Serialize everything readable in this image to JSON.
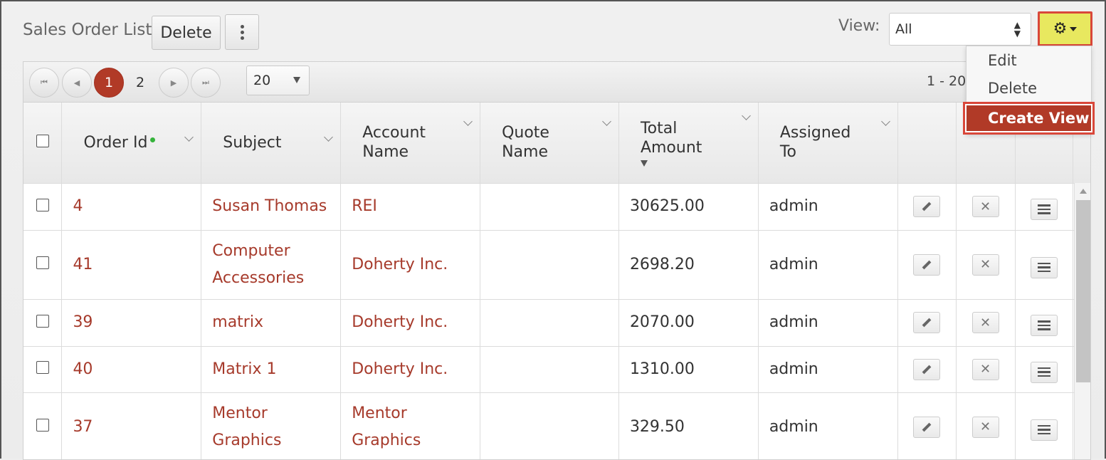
{
  "header": {
    "title": "Sales Order List",
    "delete_label": "Delete",
    "view_label": "View:",
    "view_value": "All"
  },
  "dropdown": {
    "items": [
      "Edit",
      "Delete",
      "Create View"
    ]
  },
  "pager": {
    "pages": [
      "1",
      "2"
    ],
    "current_page": "1",
    "page_size": "20",
    "range_text": "1 - 20"
  },
  "table": {
    "columns": [
      "Order Id",
      "Subject",
      "Account Name",
      "Quote Name",
      "Total Amount",
      "Assigned To"
    ],
    "rows": [
      {
        "order_id": "4",
        "subject": "Susan Thomas",
        "account": "REI",
        "quote": "",
        "total": "30625.00",
        "assigned": "admin"
      },
      {
        "order_id": "41",
        "subject": "Computer Accessories",
        "account": "Doherty Inc.",
        "quote": "",
        "total": "2698.20",
        "assigned": "admin"
      },
      {
        "order_id": "39",
        "subject": "matrix",
        "account": "Doherty Inc.",
        "quote": "",
        "total": "2070.00",
        "assigned": "admin"
      },
      {
        "order_id": "40",
        "subject": "Matrix 1",
        "account": "Doherty Inc.",
        "quote": "",
        "total": "1310.00",
        "assigned": "admin"
      },
      {
        "order_id": "37",
        "subject": "Mentor Graphics",
        "account": "Mentor Graphics",
        "quote": "",
        "total": "329.50",
        "assigned": "admin"
      }
    ]
  },
  "colors": {
    "accent": "#b13a27",
    "link": "#a63a2b",
    "highlight": "#e8e85f",
    "status_dot": "#35b33b"
  }
}
